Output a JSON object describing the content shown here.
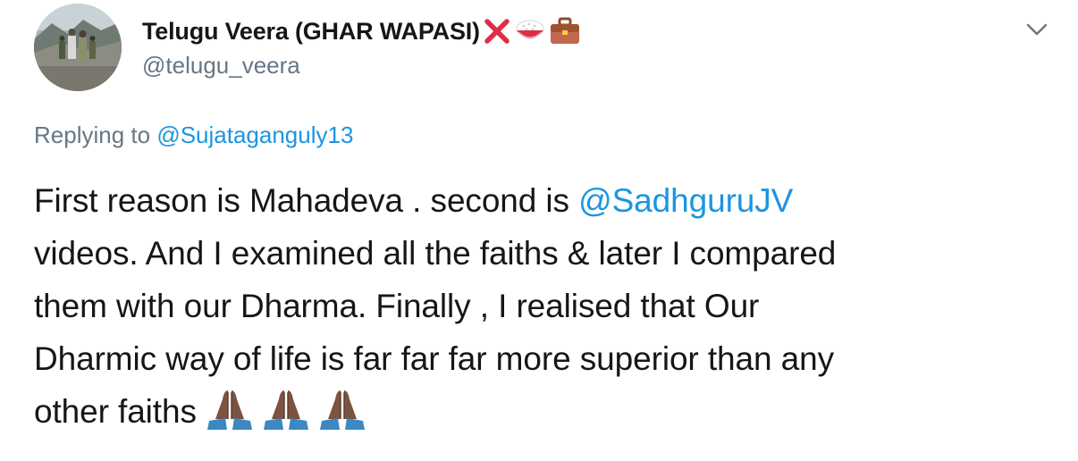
{
  "tweet": {
    "author": {
      "display_name": "Telugu Veera (GHAR WAPASI)",
      "handle": "@telugu_veera",
      "name_icons": [
        "cross-mark-icon",
        "rice-bowl-icon",
        "briefcase-icon"
      ]
    },
    "reply": {
      "prefix": "Replying to",
      "mention": "@Sujataganguly13"
    },
    "body": {
      "line1_text": "First reason is Mahadeva . second is",
      "line1_mention": "@SadhguruJV",
      "line2": "videos. And I examined all the faiths & later I compared",
      "line3": "them with our Dharma. Finally , I realised that Our",
      "line4": "Dharmic way of life is far far far more superior than any",
      "line5_text": "other  faiths",
      "line5_icons": [
        "folded-hands-icon",
        "folded-hands-icon",
        "folded-hands-icon"
      ]
    },
    "menu_icon": "chevron-down-icon"
  },
  "colors": {
    "link": "#1b95e0",
    "secondary_text": "#657786",
    "primary_text": "#14171a",
    "cross_red": "#dd2e44",
    "skin_tone": "#7c533e",
    "sleeve_blue": "#3b88c3"
  }
}
